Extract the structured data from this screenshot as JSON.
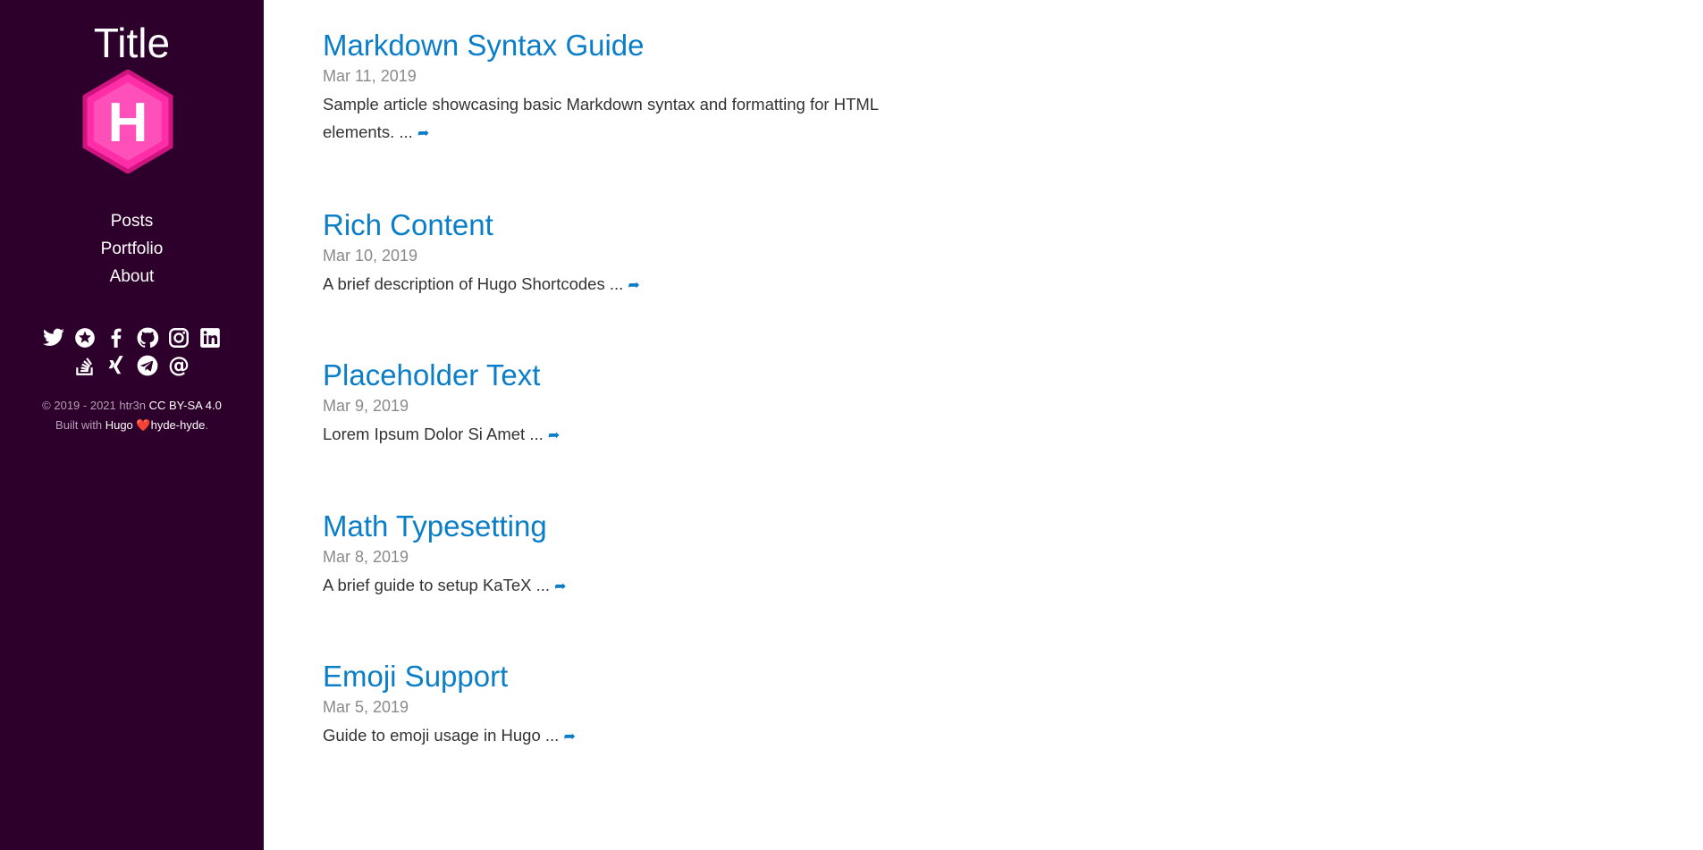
{
  "sidebar": {
    "title": "Title",
    "logo_letter": "H",
    "nav": [
      {
        "label": "Posts"
      },
      {
        "label": "Portfolio"
      },
      {
        "label": "About"
      }
    ],
    "social_icons": [
      "twitter-icon",
      "keybase-icon",
      "facebook-icon",
      "github-icon",
      "instagram-icon",
      "linkedin-icon",
      "stackoverflow-icon",
      "xing-icon",
      "telegram-icon",
      "email-icon"
    ],
    "footer": {
      "copyright": "© 2019 - 2021 htr3n",
      "license": "CC BY-SA 4.0",
      "built_with": "Built with",
      "hugo": "Hugo",
      "heart": "❤️",
      "theme": "hyde-hyde",
      "period": "."
    }
  },
  "posts": [
    {
      "title": "Markdown Syntax Guide",
      "date": "Mar 11, 2019",
      "summary": "Sample article showcasing basic Markdown syntax and formatting for HTML elements. ..."
    },
    {
      "title": "Rich Content",
      "date": "Mar 10, 2019",
      "summary": "A brief description of Hugo Shortcodes ..."
    },
    {
      "title": "Placeholder Text",
      "date": "Mar 9, 2019",
      "summary": "Lorem Ipsum Dolor Si Amet ..."
    },
    {
      "title": "Math Typesetting",
      "date": "Mar 8, 2019",
      "summary": "A brief guide to setup KaTeX ..."
    },
    {
      "title": "Emoji Support",
      "date": "Mar 5, 2019",
      "summary": "Guide to emoji usage in Hugo ..."
    }
  ],
  "read_more_glyph": "➦",
  "colors": {
    "sidebar_bg": "#2d002b",
    "link_blue": "#0b7ec8",
    "logo_pink": "#ff2da8"
  }
}
